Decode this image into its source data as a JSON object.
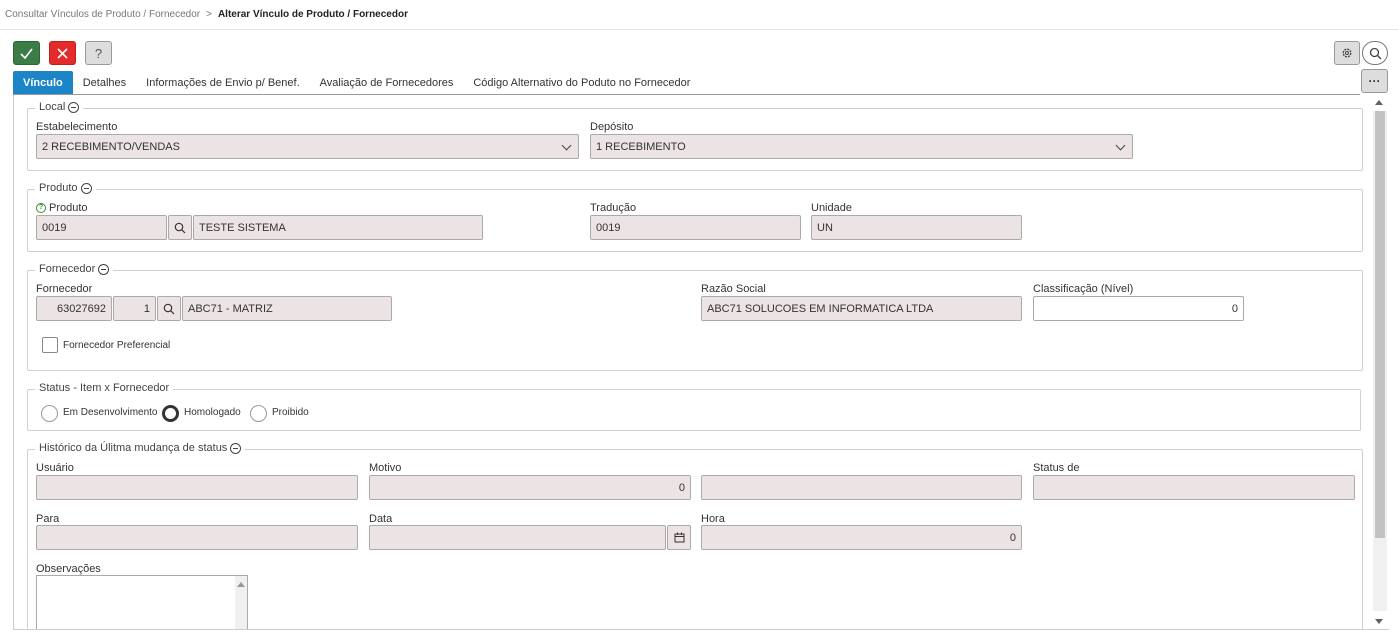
{
  "breadcrumb": {
    "parent": "Consultar Vínculos de Produto / Fornecedor",
    "separator": ">",
    "current": "Alterar Vínculo de Produto / Fornecedor"
  },
  "toolbar": {
    "confirm_icon": "check-icon",
    "cancel_icon": "close-icon",
    "help_label": "?",
    "more_label": "···"
  },
  "tabs": [
    {
      "label": "Vínculo",
      "active": true
    },
    {
      "label": "Detalhes"
    },
    {
      "label": "Informações de Envio p/ Benef."
    },
    {
      "label": "Avaliação de Fornecedores"
    },
    {
      "label": "Código Alternativo do Poduto no Fornecedor"
    }
  ],
  "local": {
    "legend": "Local",
    "estabelecimento_label": "Estabelecimento",
    "estabelecimento_value": "2 RECEBIMENTO/VENDAS",
    "deposito_label": "Depósito",
    "deposito_value": "1 RECEBIMENTO"
  },
  "produto": {
    "legend": "Produto",
    "produto_label": "Produto",
    "produto_code": "0019",
    "produto_desc": "TESTE SISTEMA",
    "traducao_label": "Tradução",
    "traducao_value": "0019",
    "unidade_label": "Unidade",
    "unidade_value": "UN"
  },
  "fornecedor": {
    "legend": "Fornecedor",
    "fornecedor_label": "Fornecedor",
    "fornecedor_code": "63027692",
    "fornecedor_seq": "1",
    "fornecedor_name": "ABC71 - MATRIZ",
    "razao_label": "Razão Social",
    "razao_value": "ABC71 SOLUCOES EM INFORMATICA LTDA",
    "classificacao_label": "Classificação (Nível)",
    "classificacao_value": "0",
    "preferencial_label": "Fornecedor Preferencial"
  },
  "status": {
    "legend": "Status - Item x Fornecedor",
    "options": [
      "Em Desenvolvimento",
      "Homologado",
      "Proibido"
    ],
    "selected": "Homologado"
  },
  "historico": {
    "legend": "Histórico da Úlitma mudança de status",
    "usuario_label": "Usuário",
    "usuario_value": "",
    "motivo_label": "Motivo",
    "motivo_value": "0",
    "motivo_desc": "",
    "status_de_label": "Status de",
    "status_de_value": "",
    "para_label": "Para",
    "para_value": "",
    "data_label": "Data",
    "data_value": "",
    "hora_label": "Hora",
    "hora_value": "0",
    "observacoes_label": "Observações"
  }
}
